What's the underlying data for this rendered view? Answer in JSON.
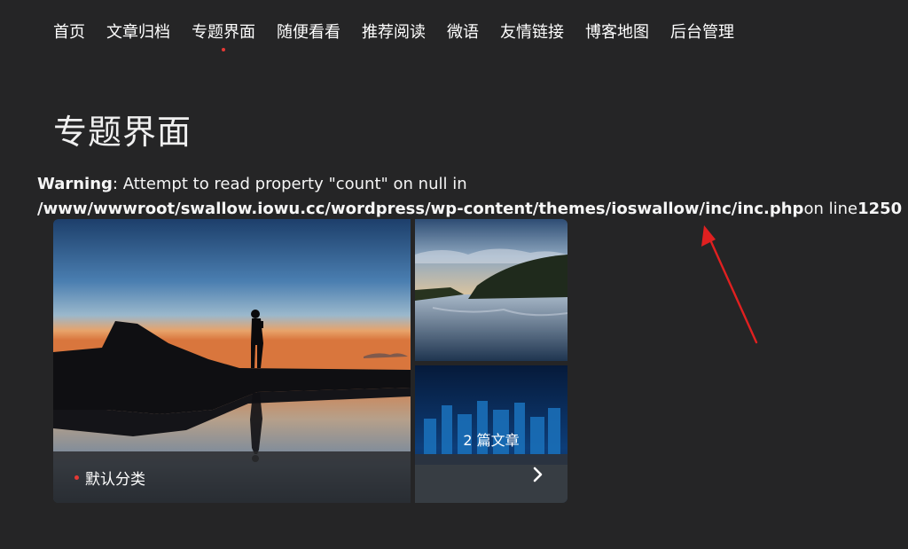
{
  "nav": {
    "items": [
      {
        "label": "首页"
      },
      {
        "label": "文章归档"
      },
      {
        "label": "专题界面",
        "active": true
      },
      {
        "label": "随便看看"
      },
      {
        "label": "推荐阅读"
      },
      {
        "label": "微语"
      },
      {
        "label": "友情链接"
      },
      {
        "label": "博客地图"
      },
      {
        "label": "后台管理"
      }
    ]
  },
  "page": {
    "title": "专题界面"
  },
  "warning": {
    "label": "Warning",
    "message": ": Attempt to read property \"count\" on null in",
    "path": "/www/wwwroot/swallow.iowu.cc/wordpress/wp-content/themes/ioswallow/inc/inc.php",
    "line_text": "on line",
    "line_number": "1250"
  },
  "topic": {
    "category_label": "默认分类",
    "post_count": "2 篇文章"
  },
  "colors": {
    "background": "#252526",
    "accent_dot": "#e53935",
    "annotation_arrow": "#e02020"
  },
  "icons": {
    "next": "chevron-right-icon"
  }
}
